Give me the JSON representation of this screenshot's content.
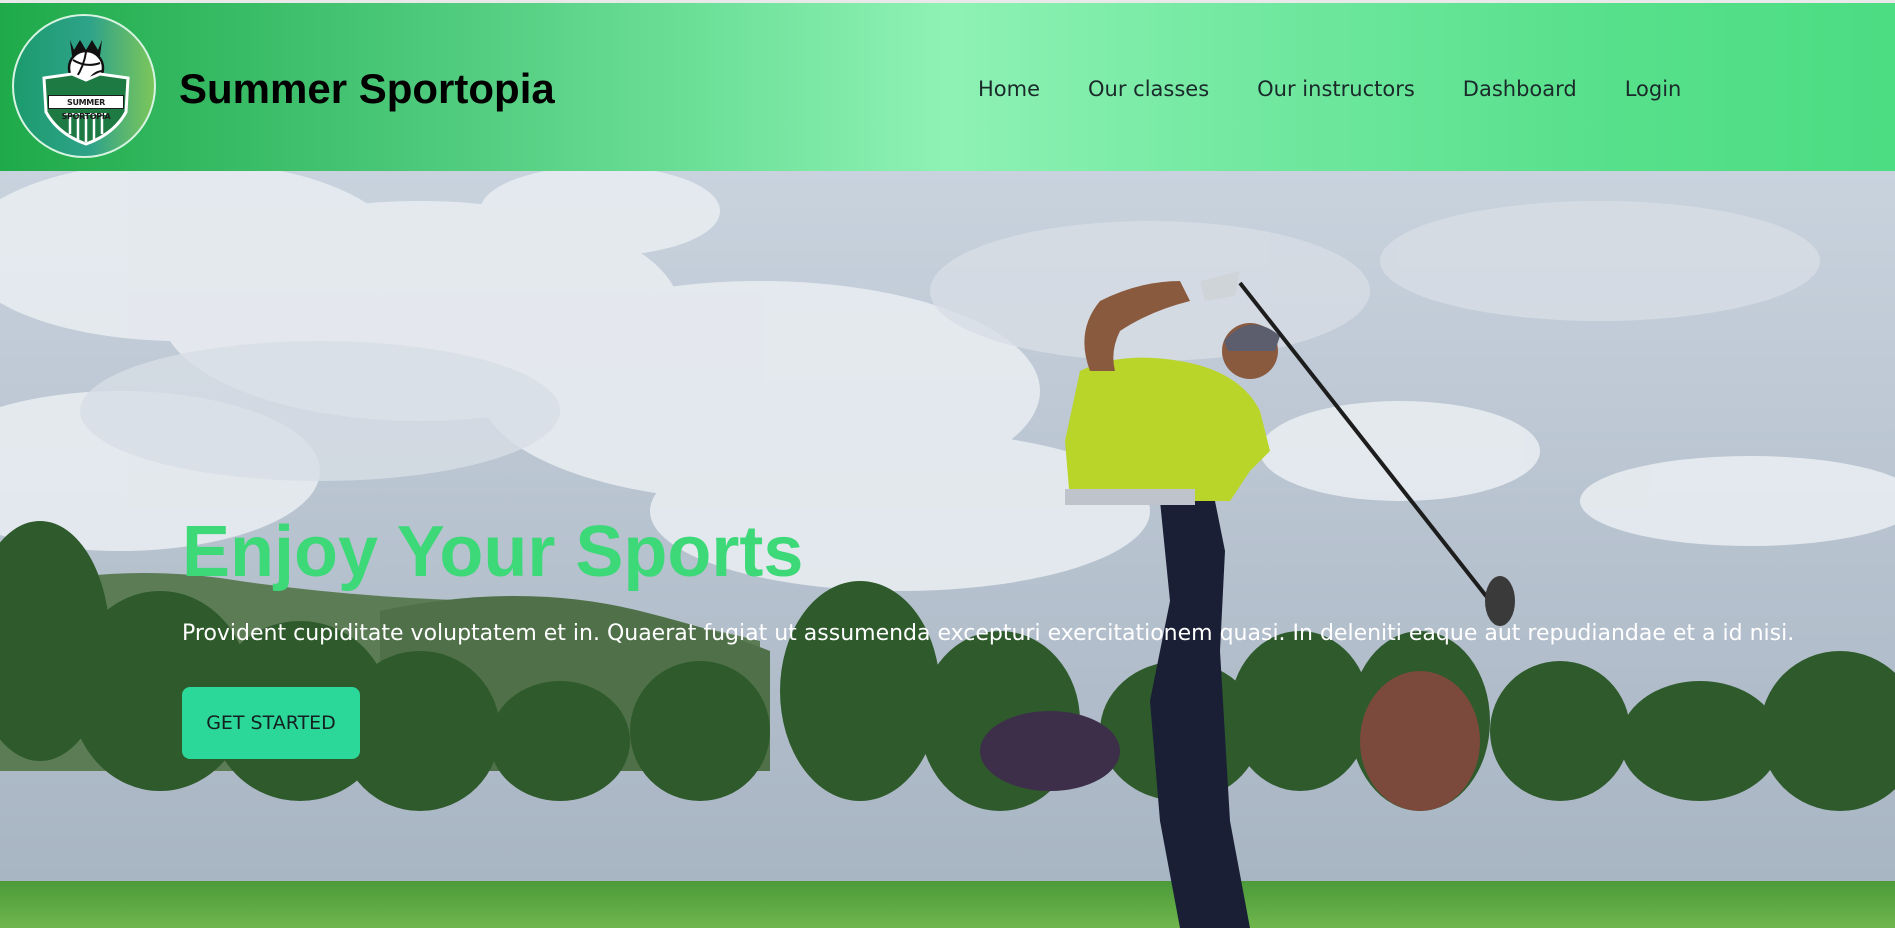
{
  "brand": {
    "title": "Summer Sportopia",
    "logo_text": "SUMMER SPORTOPIA"
  },
  "nav": {
    "items": [
      "Home",
      "Our classes",
      "Our instructors",
      "Dashboard",
      "Login"
    ]
  },
  "hero": {
    "title": "Enjoy Your Sports",
    "subtitle": "Provident cupiditate voluptatem et in. Quaerat fugiat ut assumenda excepturi exercitationem quasi. In deleniti eaque aut repudiandae et a id nisi.",
    "cta_label": "GET STARTED"
  },
  "colors": {
    "accent_green": "#3dd878",
    "button": "#2bd89a",
    "header_start": "#1faa4a",
    "header_mid": "#8ef2b5"
  },
  "icons": {
    "logo": "volleyball-crown-shield-icon"
  }
}
